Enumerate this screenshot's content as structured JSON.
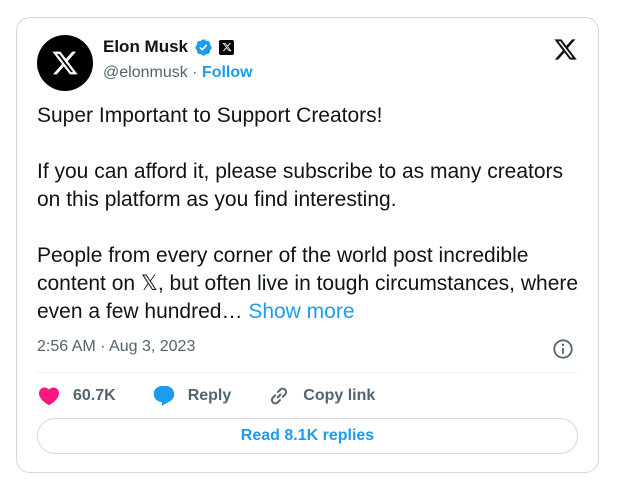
{
  "author": {
    "name": "Elon Musk",
    "handle": "@elonmusk",
    "separator": " · ",
    "follow_label": "Follow"
  },
  "tweet": {
    "text_main": "Super Important to Support Creators!\n\nIf you can afford it, please subscribe to as many creators on this platform as you find interesting.\n\nPeople from every corner of the world post incredible content on 𝕏, but often live in tough circumstances, where even a few hundred… ",
    "show_more_label": "Show more",
    "timestamp": "2:56 AM · Aug 3, 2023"
  },
  "actions": {
    "like_count": "60.7K",
    "reply_label": "Reply",
    "copy_link_label": "Copy link"
  },
  "footer": {
    "read_replies_label": "Read 8.1K replies"
  },
  "colors": {
    "accent": "#1d9bf0",
    "like": "#f91880",
    "text": "#0f1419",
    "muted": "#536471"
  },
  "icons": [
    "x-logo-icon",
    "verified-badge-icon",
    "affiliate-x-icon",
    "info-icon",
    "heart-icon",
    "reply-bubble-icon",
    "link-icon"
  ]
}
